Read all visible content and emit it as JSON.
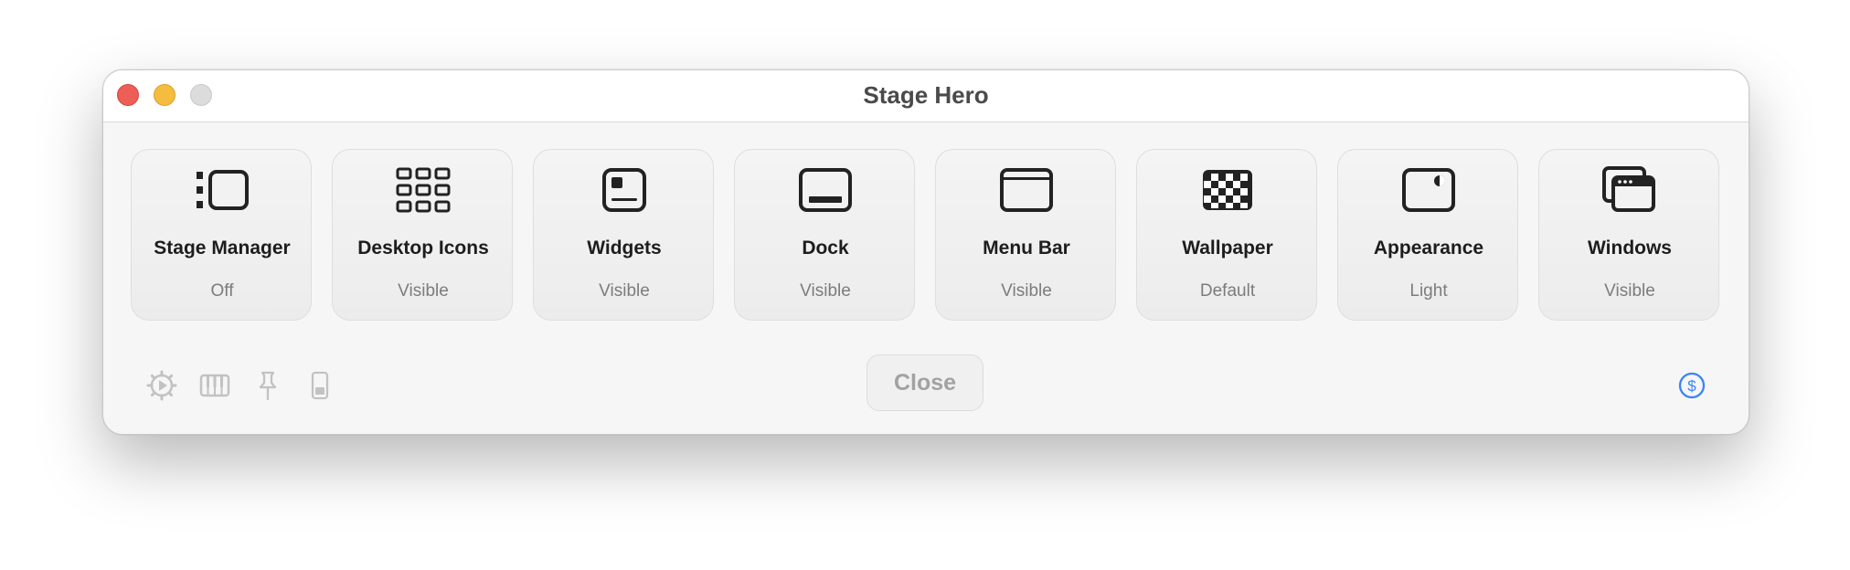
{
  "window": {
    "title": "Stage Hero"
  },
  "tiles": [
    {
      "label": "Stage Manager",
      "status": "Off",
      "icon": "stage-manager-icon"
    },
    {
      "label": "Desktop Icons",
      "status": "Visible",
      "icon": "desktop-icons-grid-icon"
    },
    {
      "label": "Widgets",
      "status": "Visible",
      "icon": "widgets-icon"
    },
    {
      "label": "Dock",
      "status": "Visible",
      "icon": "dock-icon"
    },
    {
      "label": "Menu Bar",
      "status": "Visible",
      "icon": "menu-bar-icon"
    },
    {
      "label": "Wallpaper",
      "status": "Default",
      "icon": "wallpaper-checkerboard-icon"
    },
    {
      "label": "Appearance",
      "status": "Light",
      "icon": "appearance-icon"
    },
    {
      "label": "Windows",
      "status": "Visible",
      "icon": "windows-icon"
    }
  ],
  "footer": {
    "close_label": "Close",
    "icons": [
      "settings-gear-icon",
      "keyboard-piano-icon",
      "pin-icon",
      "device-phone-icon"
    ],
    "donate_icon": "dollar-circle-icon"
  },
  "colors": {
    "close_button_dot": "#ee5e57",
    "minimize_button_dot": "#f5bd3f",
    "zoom_button_dot": "#dcdcdc",
    "donate_accent": "#3b82f6"
  }
}
